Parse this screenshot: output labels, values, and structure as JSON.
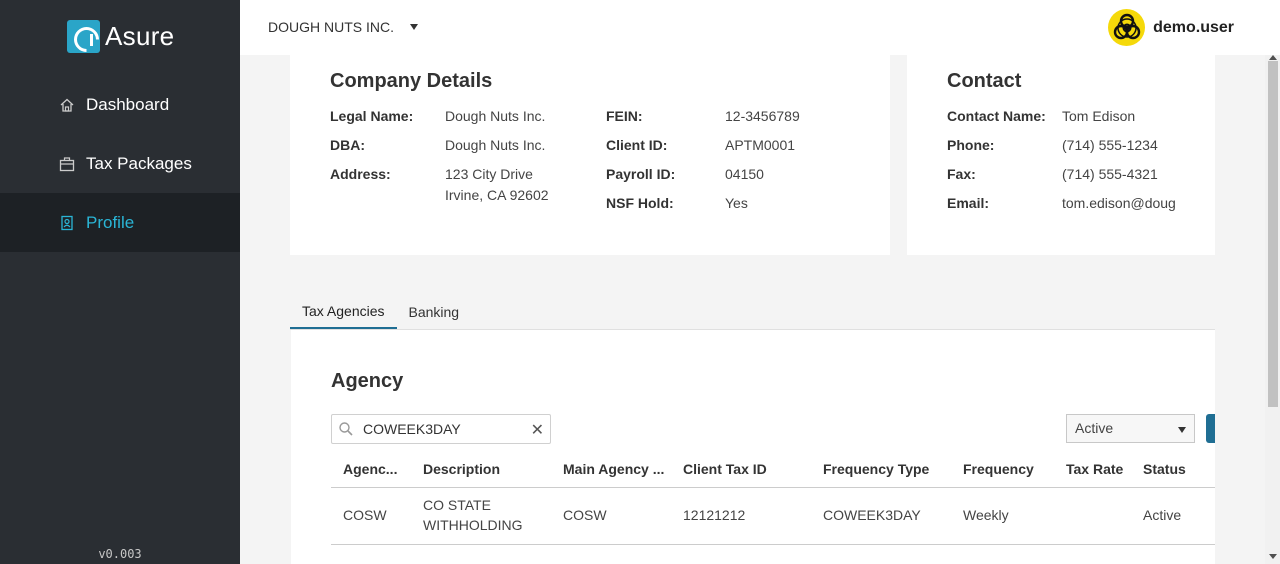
{
  "app": {
    "logo_text": "Asure",
    "version": "v0.003"
  },
  "sidebar": {
    "items": [
      {
        "label": "Dashboard",
        "icon": "home-icon",
        "active": false
      },
      {
        "label": "Tax Packages",
        "icon": "briefcase-icon",
        "active": false
      },
      {
        "label": "Profile",
        "icon": "profile-icon",
        "active": true
      }
    ]
  },
  "topbar": {
    "company": "DOUGH NUTS INC.",
    "user_name": "demo.user",
    "avatar_icon": "biohazard-icon"
  },
  "company_details": {
    "title": "Company Details",
    "legal_name_label": "Legal Name:",
    "legal_name": "Dough Nuts Inc.",
    "dba_label": "DBA:",
    "dba": "Dough Nuts Inc.",
    "address_label": "Address:",
    "address_line1": "123 City Drive",
    "address_line2": "Irvine, CA 92602",
    "fein_label": "FEIN:",
    "fein": "12-3456789",
    "client_id_label": "Client ID:",
    "client_id": "APTM0001",
    "payroll_id_label": "Payroll ID:",
    "payroll_id": "04150",
    "nsf_hold_label": "NSF Hold:",
    "nsf_hold": "Yes"
  },
  "contact": {
    "title": "Contact",
    "name_label": "Contact Name:",
    "name": "Tom Edison",
    "phone_label": "Phone:",
    "phone": "(714) 555-1234",
    "fax_label": "Fax:",
    "fax": "(714) 555-4321",
    "email_label": "Email:",
    "email": "tom.edison@doug"
  },
  "tabs": [
    {
      "label": "Tax Agencies",
      "active": true
    },
    {
      "label": "Banking",
      "active": false
    }
  ],
  "agency": {
    "title": "Agency",
    "search_value": "COWEEK3DAY",
    "status_filter": "Active",
    "columns": [
      "Agenc...",
      "Description",
      "Main Agency ...",
      "Client Tax ID",
      "Frequency Type",
      "Frequency",
      "Tax Rate",
      "Status"
    ],
    "rows": [
      {
        "agency": "COSW",
        "description_line1": "CO STATE",
        "description_line2": "WITHHOLDING",
        "main_agency": "COSW",
        "client_tax_id": "12121212",
        "frequency_type": "COWEEK3DAY",
        "frequency": "Weekly",
        "tax_rate": "",
        "status": "Active"
      }
    ]
  },
  "colors": {
    "sidebar_bg": "#2a2e33",
    "sidebar_active_bg": "#1d2125",
    "accent": "#2ab5d6",
    "primary": "#1f6e93"
  }
}
